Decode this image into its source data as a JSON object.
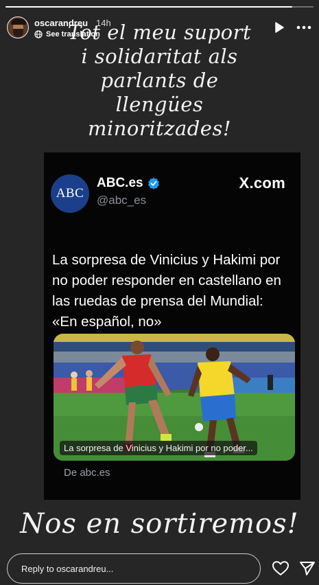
{
  "story": {
    "progress": 0.93
  },
  "header": {
    "username": "oscarandreu",
    "time": "14h",
    "translation_label": "See translation"
  },
  "overlay_top": {
    "lines": [
      "Tot el meu suport",
      "i solidaritat als",
      "parlants de",
      "llengües",
      "minoritzades!"
    ]
  },
  "card": {
    "logo_text": "ABC",
    "account_name": "ABC.es",
    "handle": "@abc_es",
    "brand": "X.com",
    "tweet_text": "La sorpresa de Vinicius y Hakimi por no poder responder en castellano en las ruedas de prensa del Mundial: «En español, no»",
    "media_caption": "La sorpresa de Vinicius y Hakimi por no poder...",
    "source": "De abc.es"
  },
  "overlay_bottom": {
    "text": "Nos en sortiremos!"
  },
  "footer": {
    "reply_placeholder": "Reply to oscarandreu..."
  },
  "icons": {
    "play": "play-icon",
    "more": "more-icon",
    "globe": "globe-icon",
    "verified": "verified-badge-icon",
    "heart": "heart-icon",
    "send": "send-icon"
  },
  "colors": {
    "background": "#262626",
    "card": "#050505",
    "abc_blue": "#1c3f8c",
    "verified_blue": "#1d9bf0",
    "handle_gray": "#8a8f95"
  }
}
